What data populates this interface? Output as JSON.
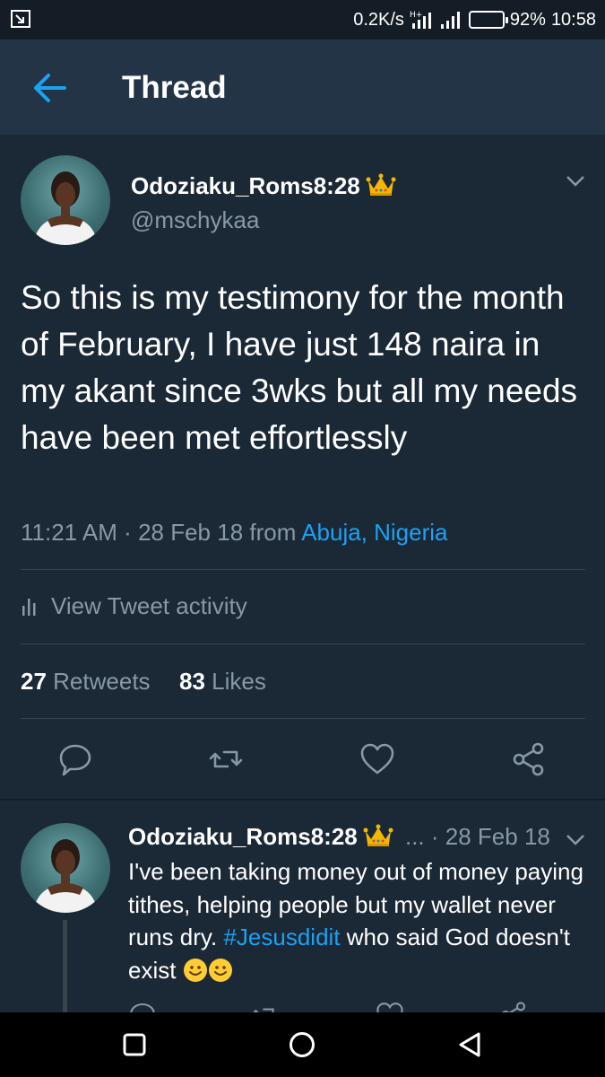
{
  "status_bar": {
    "speed": "0.2K/s",
    "network": "H+",
    "battery": "92%",
    "time": "10:58"
  },
  "header": {
    "title": "Thread",
    "back_icon": "arrow-left-icon"
  },
  "main_tweet": {
    "display_name": "Odoziaku_Roms8:28",
    "handle": "@mschykaa",
    "text": "So this is my testimony for the month of February, I have just 148 naira in my akant since 3wks but all my needs have been met effortlessly",
    "time": "11:21 AM",
    "date": "28 Feb 18",
    "from_label": "from",
    "location": "Abuja, Nigeria",
    "activity_label": "View Tweet activity",
    "retweets_count": "27",
    "retweets_label": "Retweets",
    "likes_count": "83",
    "likes_label": "Likes"
  },
  "reply_tweet": {
    "display_name": "Odoziaku_Roms8:28",
    "ellipsis": "...",
    "date": "· 28 Feb 18",
    "text_before": "I've been taking money out of money paying tithes, helping people but my wallet never runs dry.",
    "hashtag": "#Jesusdidit",
    "text_after": "who said God doesn't exist"
  },
  "colors": {
    "background": "#1b2836",
    "header": "#243447",
    "accent": "#1da1f2",
    "secondary_text": "#8899a6",
    "divider": "#38444d",
    "crown": "#f5b800"
  }
}
